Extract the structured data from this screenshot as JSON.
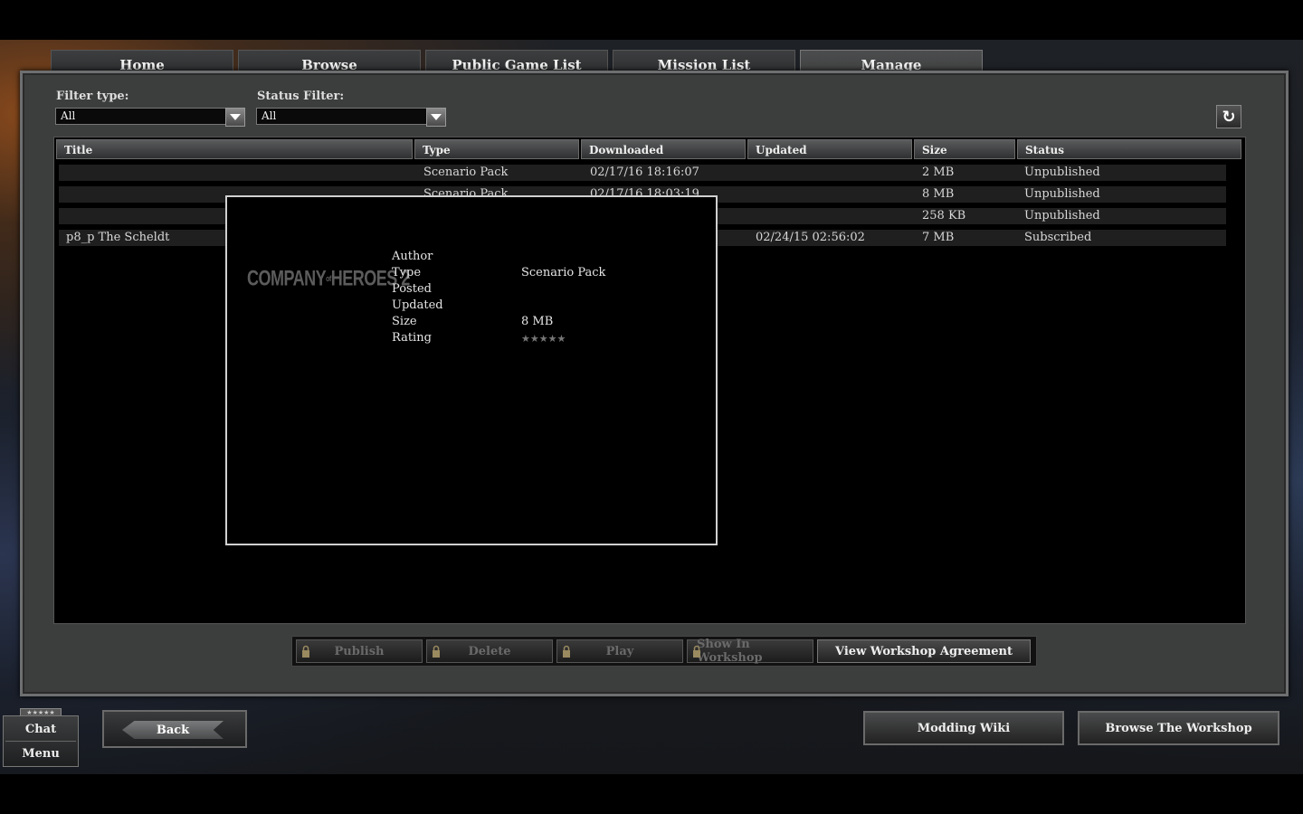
{
  "tabs": [
    "Home",
    "Browse",
    "Public Game List",
    "Mission List",
    "Manage"
  ],
  "active_tab": "Manage",
  "filters": {
    "filter_type_label": "Filter type:",
    "filter_type_value": "All",
    "status_filter_label": "Status Filter:",
    "status_filter_value": "All"
  },
  "refresh_icon": "↻",
  "table": {
    "columns": [
      "Title",
      "Type",
      "Downloaded",
      "Updated",
      "Size",
      "Status"
    ],
    "rows": [
      {
        "title": "",
        "type": "Scenario Pack",
        "downloaded": "02/17/16 18:16:07",
        "updated": "",
        "size": "2 MB",
        "status": "Unpublished"
      },
      {
        "title": "",
        "type": "Scenario Pack",
        "downloaded": "02/17/16 18:03:19",
        "updated": "",
        "size": "8 MB",
        "status": "Unpublished"
      },
      {
        "title": "",
        "type": "",
        "downloaded": "",
        "updated": "",
        "size": "258 KB",
        "status": "Unpublished"
      },
      {
        "title": "p8_p The Scheldt",
        "type": "",
        "downloaded": "",
        "updated": "02/24/15 02:56:02",
        "size": "7 MB",
        "status": "Subscribed"
      }
    ]
  },
  "popup": {
    "logo_text": "COMPANY",
    "logo_of": "of",
    "logo_text2": "HEROES 2",
    "labels": [
      "Author",
      "Type",
      "Posted",
      "Updated",
      "Size",
      "Rating"
    ],
    "values": {
      "author": "",
      "type": "Scenario Pack",
      "posted": "",
      "updated": "",
      "size": "8 MB",
      "rating": "★★★★★"
    }
  },
  "actions": {
    "publish": "Publish",
    "delete": "Delete",
    "play": "Play",
    "show_in_workshop": "Show In Workshop",
    "view_agreement": "View Workshop Agreement"
  },
  "bottom": {
    "chat": "Chat",
    "menu": "Menu",
    "chat_stars": "★★★★★",
    "back": "Back",
    "modding_wiki": "Modding Wiki",
    "browse_workshop": "Browse The Workshop"
  }
}
